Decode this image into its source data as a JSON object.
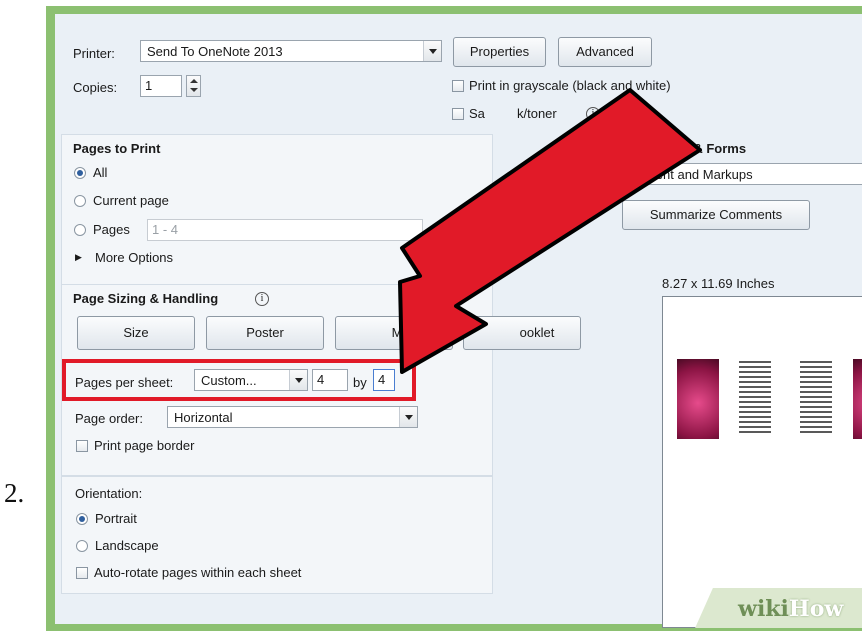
{
  "step_number": "2.",
  "printer": {
    "label": "Printer:",
    "value": "Send To OneNote 2013",
    "properties_button": "Properties",
    "advanced_button": "Advanced"
  },
  "copies": {
    "label": "Copies:",
    "value": "1"
  },
  "options": {
    "grayscale": "Print in grayscale (black and white)",
    "save_ink_visible": "Sa",
    "save_ink_tail": "k/toner"
  },
  "pages_to_print": {
    "heading": "Pages to Print",
    "all": "All",
    "current_page": "Current page",
    "pages": "Pages",
    "pages_range": "1 - 4",
    "more_options": "More Options"
  },
  "comments_forms": {
    "heading_partial": "ents & Forms",
    "dropdown_value": "ocument and Markups",
    "summarize_button": "Summarize Comments"
  },
  "page_sizing": {
    "heading": "Page Sizing & Handling",
    "size_button": "Size",
    "poster_button": "Poster",
    "multiple_button": "Multip",
    "booklet_button": "ooklet",
    "pages_per_sheet_label": "Pages per sheet:",
    "pages_per_sheet_value": "Custom...",
    "cols": "4",
    "by_label": "by",
    "rows": "4",
    "page_order_label": "Page order:",
    "page_order_value": "Horizontal",
    "print_page_border": "Print page border"
  },
  "orientation": {
    "heading": "Orientation:",
    "portrait": "Portrait",
    "landscape": "Landscape",
    "auto_rotate": "Auto-rotate pages within each sheet"
  },
  "preview": {
    "size_label": "8.27 x 11.69 Inches"
  },
  "watermark": {
    "part1": "wiki",
    "part2": "How"
  },
  "colors": {
    "highlight": "#e11a28",
    "frame": "#8cc071",
    "dialog_bg": "#eaf0f6"
  }
}
